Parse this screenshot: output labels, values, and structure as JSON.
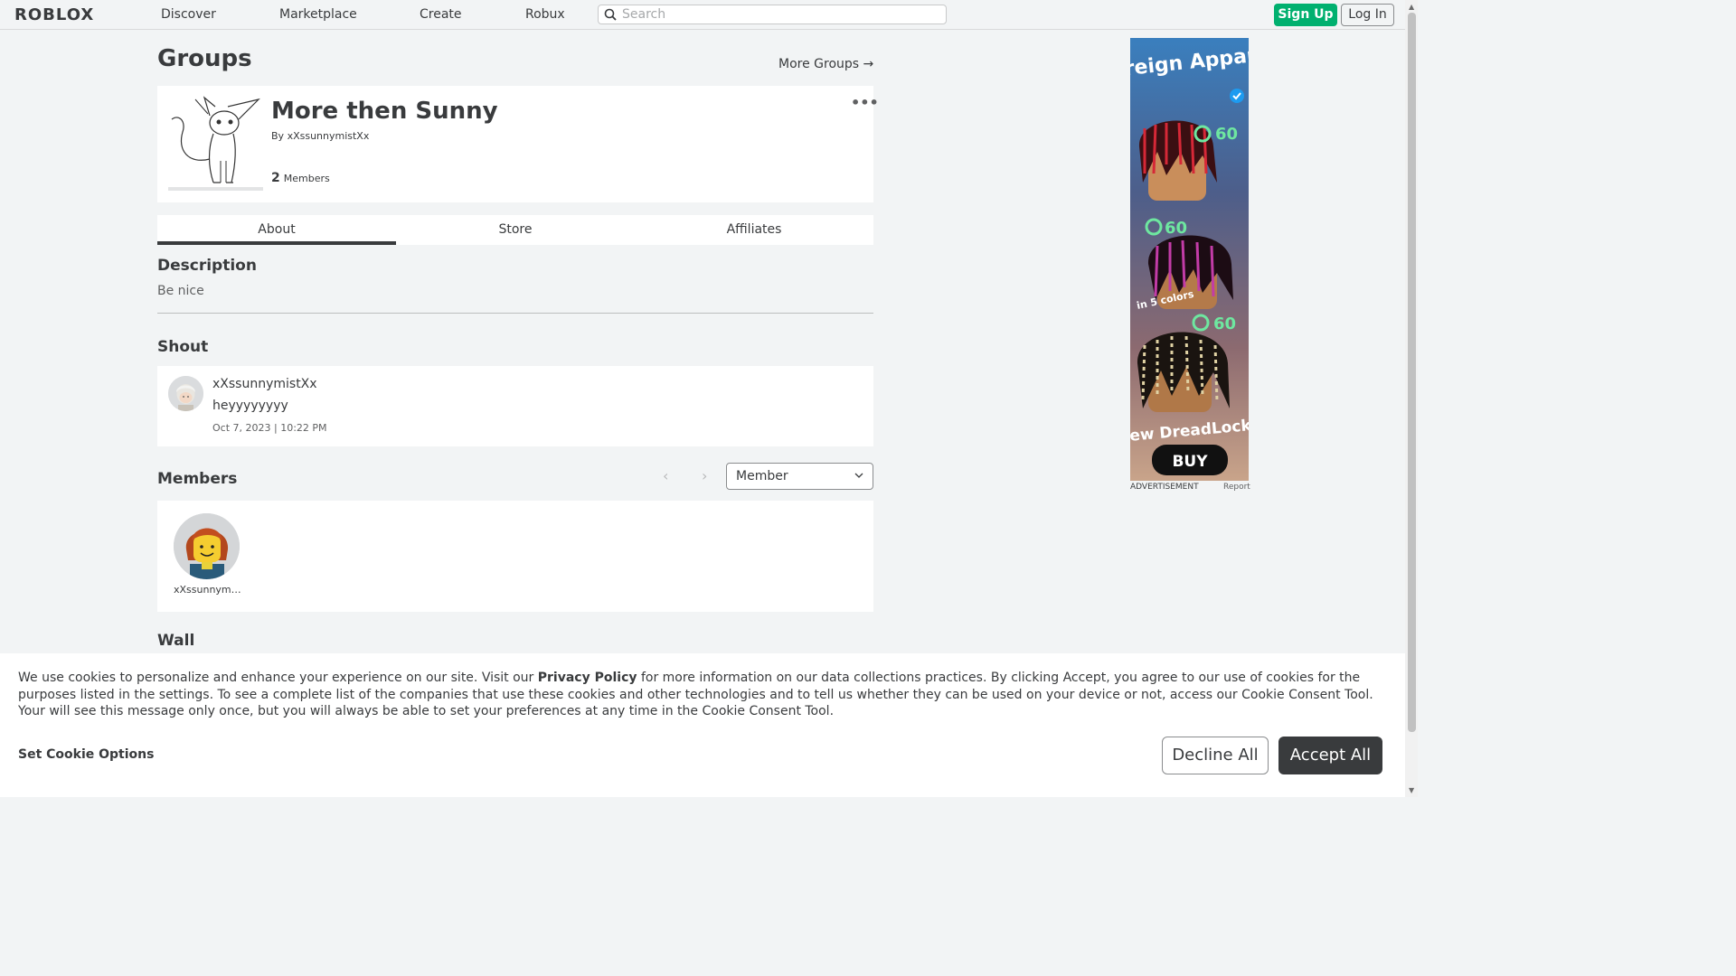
{
  "header": {
    "logo": "ROBLOX",
    "nav": [
      "Discover",
      "Marketplace",
      "Create",
      "Robux"
    ],
    "search_placeholder": "Search",
    "signup": "Sign Up",
    "login": "Log In"
  },
  "page": {
    "title": "Groups",
    "more_groups": "More Groups →"
  },
  "group": {
    "name": "More then Sunny",
    "by_prefix": "By",
    "owner": "xXssunnymistXx",
    "member_count": "2",
    "members_label": "Members",
    "menu": "•••"
  },
  "tabs": [
    "About",
    "Store",
    "Affiliates"
  ],
  "active_tab": "About",
  "description": {
    "heading": "Description",
    "text": "Be nice"
  },
  "shout": {
    "heading": "Shout",
    "user": "xXssunnymistXx",
    "body": "heyyyyyyyy",
    "time": "Oct 7, 2023 | 10:22 PM"
  },
  "members": {
    "heading": "Members",
    "role": "Member",
    "list": [
      {
        "name": "xXssunnymi..."
      }
    ]
  },
  "wall": {
    "heading": "Wall"
  },
  "ad": {
    "text_top": "Foreign Apparel",
    "price_1": "60",
    "price_2": "60",
    "price_3": "60",
    "colors_line": "in 5 colors",
    "headline": "new DreadLocks",
    "buy": "BUY",
    "label": "ADVERTISEMENT",
    "report": "Report"
  },
  "cookie": {
    "text_before": "We use cookies to personalize and enhance your experience on our site. Visit our ",
    "privacy_link": "Privacy Policy",
    "text_after": " for more information on our data collections practices. By clicking Accept, you agree to our use of cookies for the purposes listed in the settings. To see a complete list of the companies that use these cookies and other technologies and to tell us whether they can be used on your device or not, access our Cookie Consent Tool. Your will see this message only once, but you will always be able to set your preferences at any time in the Cookie Consent Tool.",
    "set_options": "Set Cookie Options",
    "decline": "Decline All",
    "accept": "Accept All"
  },
  "colors": {
    "brand_green": "#00b06f",
    "text_dark": "#393b3d",
    "background": "#f2f4f5",
    "ad_price_green": "#6ee7a0"
  }
}
